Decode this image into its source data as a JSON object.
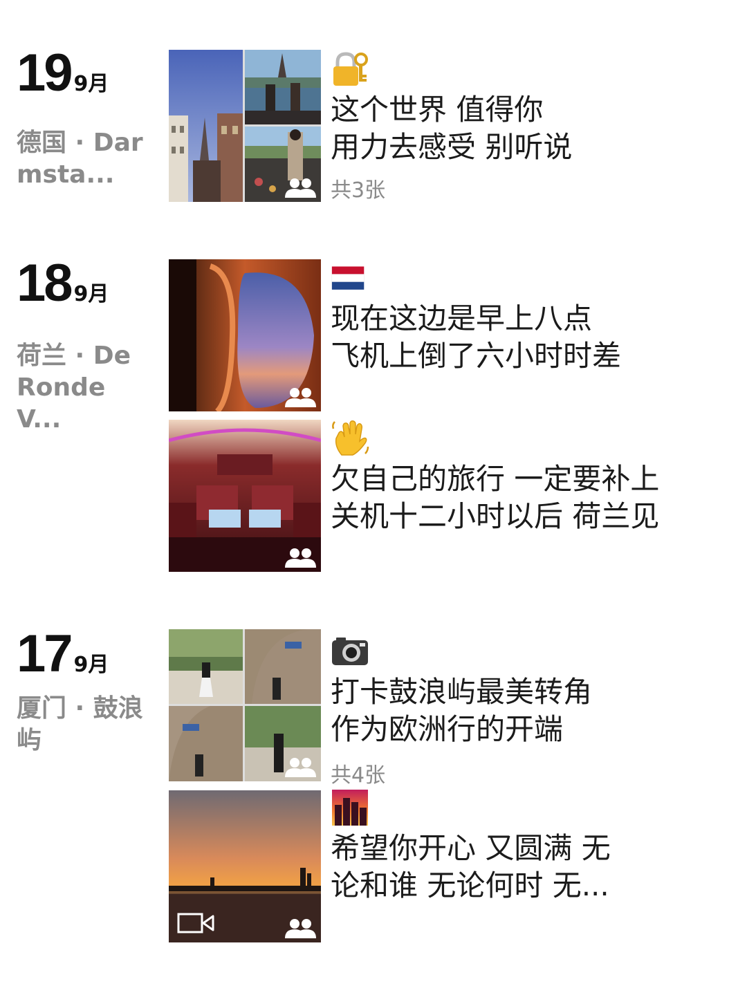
{
  "feed": [
    {
      "day": "19",
      "month": "9月",
      "location": "德国 · Darmsta...",
      "posts": [
        {
          "emoji": "lock-with-key-emoji",
          "lines": [
            "这个世界 值得你",
            "用力去感受 别听说"
          ],
          "count": "共3张",
          "thumb_type": "triple-photo",
          "shared_with_group": true
        }
      ]
    },
    {
      "day": "18",
      "month": "9月",
      "location": "荷兰 · De Ronde V...",
      "posts": [
        {
          "emoji": "netherlands-flag-emoji",
          "lines": [
            "现在这边是早上八点",
            "飞机上倒了六小时时差"
          ],
          "thumb_type": "single-photo-airplane-window",
          "shared_with_group": true
        },
        {
          "emoji": "waving-hand-emoji",
          "lines": [
            "欠自己的旅行 一定要补上",
            "关机十二小时以后 荷兰见"
          ],
          "thumb_type": "single-photo-cabin",
          "shared_with_group": true
        }
      ]
    },
    {
      "day": "17",
      "month": "9月",
      "location": "厦门 · 鼓浪屿",
      "posts": [
        {
          "emoji": "camera-emoji",
          "lines": [
            "打卡鼓浪屿最美转角",
            "作为欧洲行的开端"
          ],
          "count": "共4张",
          "thumb_type": "quad-photo",
          "shared_with_group": true
        },
        {
          "emoji": "city-sunset-emoji",
          "lines": [
            "希望你开心 又圆满 无",
            "论和谁 无论何时 无..."
          ],
          "thumb_type": "video-sunset",
          "shared_with_group": true
        }
      ]
    }
  ]
}
